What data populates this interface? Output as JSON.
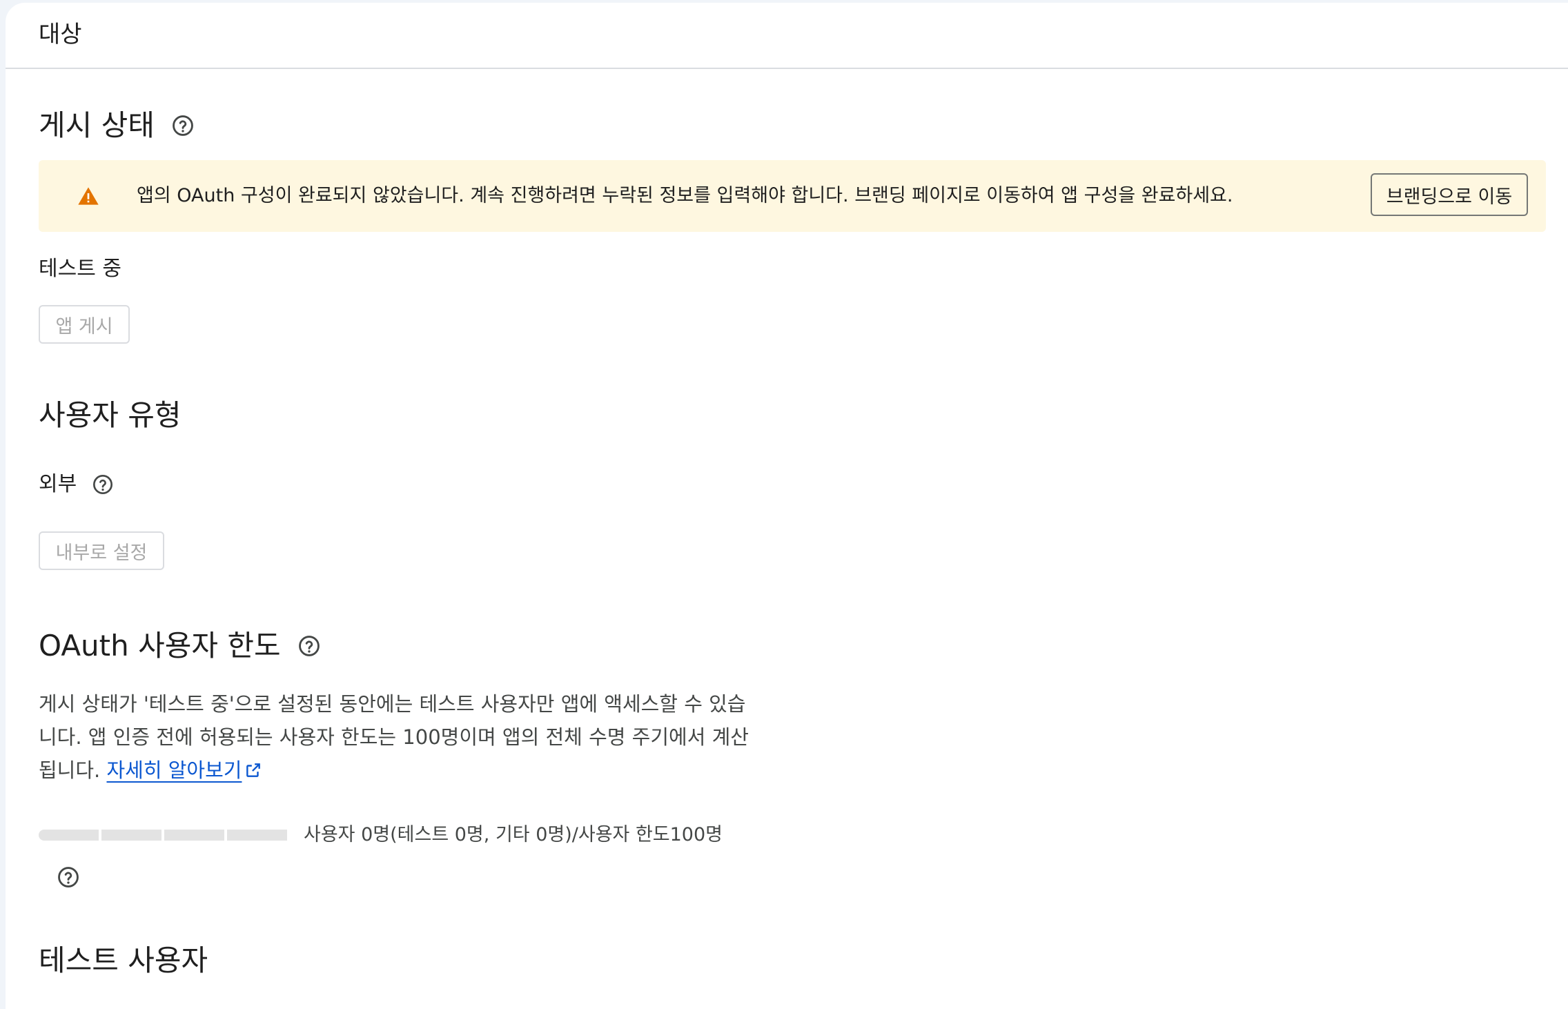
{
  "header": {
    "title": "대상"
  },
  "publishing_status": {
    "title": "게시 상태",
    "warning": {
      "text": "앱의 OAuth 구성이 완료되지 않았습니다. 계속 진행하려면 누락된 정보를 입력해야 합니다. 브랜딩 페이지로 이동하여 앱 구성을 완료하세요.",
      "button_label": "브랜딩으로 이동",
      "color": "#e37400"
    },
    "status_label": "테스트 중",
    "publish_button_label": "앱 게시"
  },
  "user_type": {
    "title": "사용자 유형",
    "value": "외부",
    "make_internal_button_label": "내부로 설정"
  },
  "oauth_user_cap": {
    "title": "OAuth 사용자 한도",
    "description": "게시 상태가 '테스트 중'으로 설정된 동안에는 테스트 사용자만 앱에 액세스할 수 있습니다. 앱 인증 전에 허용되는 사용자 한도는 100명이며 앱의 전체 수명 주기에서 계산됩니다.",
    "learn_more_label": "자세히 알아보기",
    "usage_text": "사용자 0명(테스트 0명, 기타 0명)/사용자 한도100명",
    "used_fraction": 0
  },
  "test_users": {
    "title": "테스트 사용자"
  },
  "icons": {
    "help": "help-circle-icon",
    "warning": "warning-triangle-icon",
    "external_link": "open-in-new-icon"
  },
  "colors": {
    "warning_background": "#fef7e0",
    "link": "#0b57d0"
  }
}
